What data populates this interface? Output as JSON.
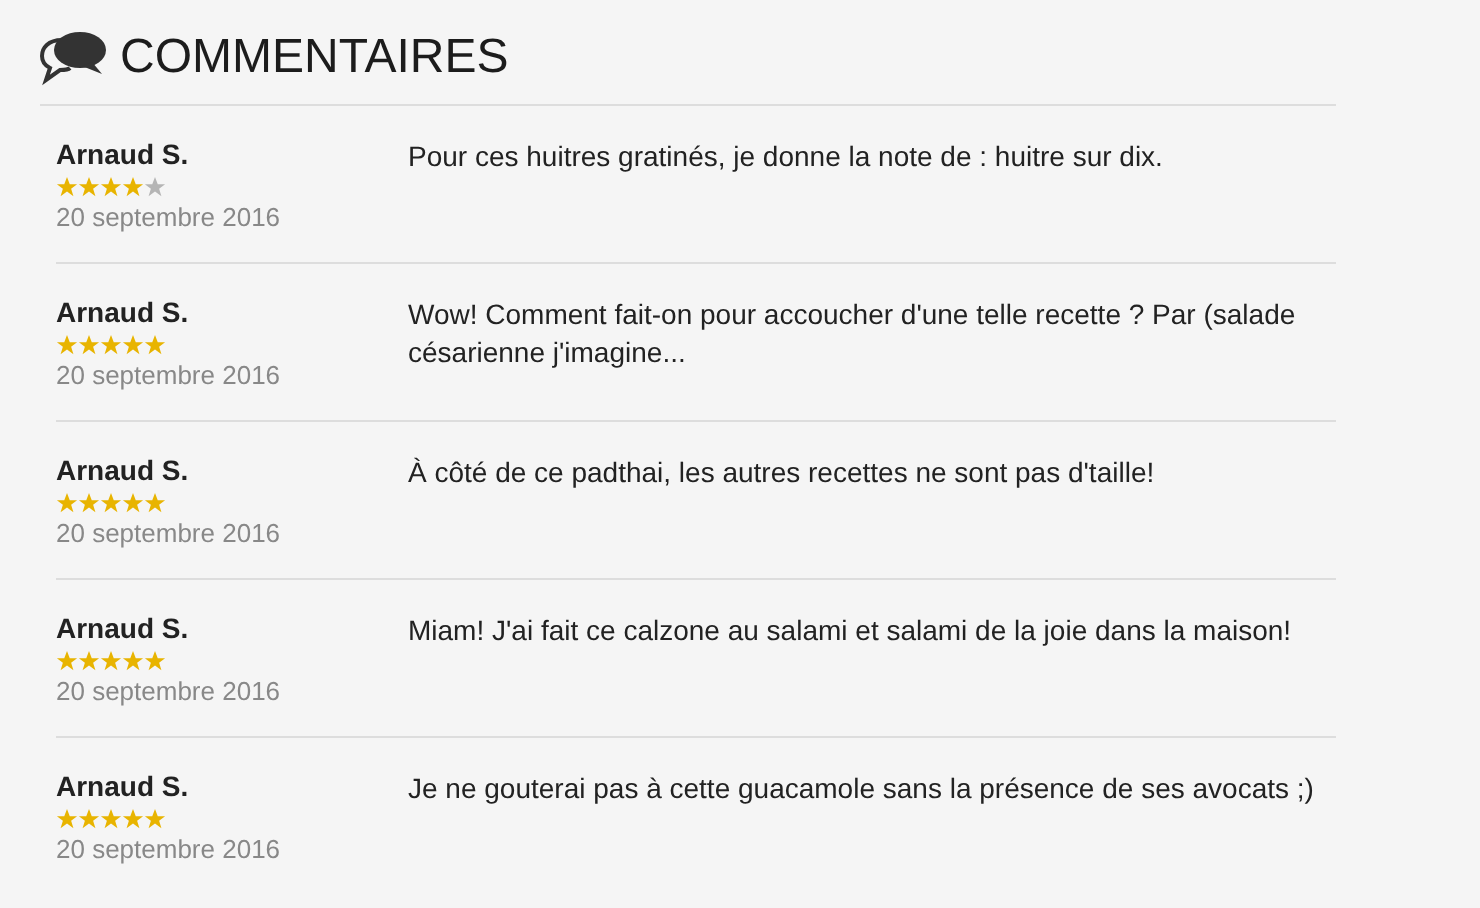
{
  "heading": "COMMENTAIRES",
  "comments": [
    {
      "author": "Arnaud S.",
      "stars": 4,
      "date": "20 septembre 2016",
      "text": "Pour ces huitres gratinés, je donne la note de : huitre sur dix."
    },
    {
      "author": "Arnaud S.",
      "stars": 5,
      "date": "20 septembre 2016",
      "text": "Wow! Comment fait-on pour accoucher d'une telle recette ? Par (salade césarienne j'imagine..."
    },
    {
      "author": "Arnaud S.",
      "stars": 5,
      "date": "20 septembre 2016",
      "text": "À côté de ce padthai, les autres recettes ne sont pas d'taille!"
    },
    {
      "author": "Arnaud S.",
      "stars": 5,
      "date": "20 septembre 2016",
      "text": "Miam! J'ai fait ce calzone au salami et salami de la joie dans la maison!"
    },
    {
      "author": "Arnaud S.",
      "stars": 5,
      "date": "20 septembre 2016",
      "text": "Je ne gouterai pas à cette guacamole sans la présence de ses avocats ;)"
    }
  ]
}
